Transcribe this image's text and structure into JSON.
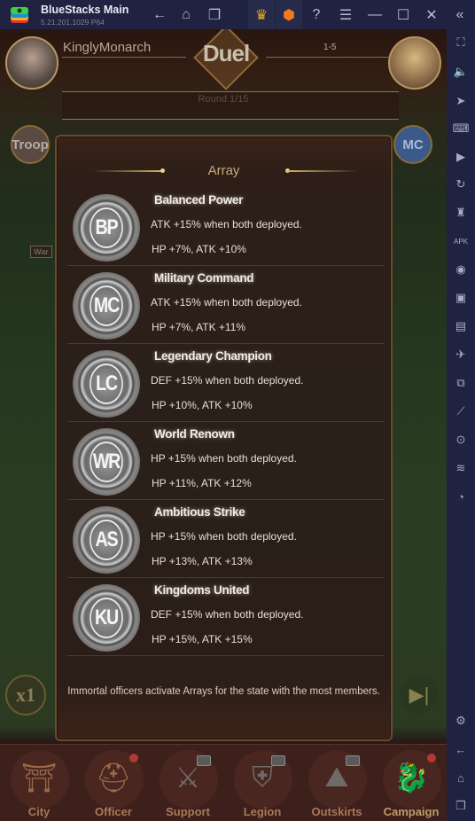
{
  "window": {
    "app_title": "BlueStacks Main",
    "version": "5.21.201.1029  P64",
    "toolbar": [
      {
        "name": "back-icon",
        "glyph": "←"
      },
      {
        "name": "home-icon",
        "glyph": "⌂"
      },
      {
        "name": "multi-instance-icon",
        "glyph": "❐"
      },
      {
        "name": "crown-icon",
        "glyph": "♛"
      },
      {
        "name": "hex-badge-icon",
        "glyph": "⬢"
      },
      {
        "name": "help-icon",
        "glyph": "?"
      },
      {
        "name": "menu-icon",
        "glyph": "☰"
      },
      {
        "name": "minimize-icon",
        "glyph": "—"
      },
      {
        "name": "maximize-icon",
        "glyph": "☐"
      },
      {
        "name": "close-icon",
        "glyph": "✕"
      },
      {
        "name": "collapse-sidebar-icon",
        "glyph": "«"
      }
    ]
  },
  "sidebar": {
    "items": [
      {
        "name": "fullscreen-icon",
        "glyph": "⛶"
      },
      {
        "name": "mute-icon",
        "glyph": "🔈"
      },
      {
        "name": "pointer-icon",
        "glyph": "➤"
      },
      {
        "name": "keyboard-icon",
        "glyph": "⌨"
      },
      {
        "name": "macro-play-icon",
        "glyph": "▶"
      },
      {
        "name": "rotate-sync-icon",
        "glyph": "↻"
      },
      {
        "name": "gamepad-controls-icon",
        "glyph": "♜"
      },
      {
        "name": "apk-install-icon",
        "glyph": "APK"
      },
      {
        "name": "screenshot-icon",
        "glyph": "◉"
      },
      {
        "name": "record-screen-icon",
        "glyph": "▣"
      },
      {
        "name": "media-folder-icon",
        "glyph": "▤"
      },
      {
        "name": "airplane-mode-icon",
        "glyph": "✈"
      },
      {
        "name": "multi-window-icon",
        "glyph": "⧉"
      },
      {
        "name": "shake-rotate-icon",
        "glyph": "⟋"
      },
      {
        "name": "location-icon",
        "glyph": "⊙"
      },
      {
        "name": "layers-icon",
        "glyph": "≋"
      },
      {
        "name": "performance-gauge-icon",
        "glyph": "◔"
      }
    ],
    "bottom": [
      {
        "name": "settings-icon",
        "glyph": "⚙"
      },
      {
        "name": "back-nav-icon",
        "glyph": "←"
      },
      {
        "name": "home-nav-icon",
        "glyph": "⌂"
      },
      {
        "name": "recent-apps-icon",
        "glyph": "❐"
      }
    ]
  },
  "game": {
    "player_name": "KinglyMonarch",
    "mode_title": "Duel",
    "stage": "1-5",
    "round": "Round 1/15",
    "left_badge": "Troop",
    "right_badge": "MC",
    "war_tag": "War",
    "speed": "x1",
    "skip_glyph": "▶|"
  },
  "array_modal": {
    "title": "Array",
    "rows": [
      {
        "abbr": "BP",
        "name": "Balanced Power",
        "desc": "ATK +15% when both deployed.",
        "stats": "HP +7%, ATK +10%"
      },
      {
        "abbr": "MC",
        "name": "Military Command",
        "desc": "ATK +15% when both deployed.",
        "stats": "HP +7%, ATK +11%"
      },
      {
        "abbr": "LC",
        "name": "Legendary Champion",
        "desc": "DEF +15% when both deployed.",
        "stats": "HP +10%, ATK +10%"
      },
      {
        "abbr": "WR",
        "name": "World Renown",
        "desc": "HP +15% when both deployed.",
        "stats": "HP +11%, ATK +12%"
      },
      {
        "abbr": "AS",
        "name": "Ambitious Strike",
        "desc": "HP +15% when both deployed.",
        "stats": "HP +13%, ATK +13%"
      },
      {
        "abbr": "KU",
        "name": "Kingdoms United",
        "desc": "DEF +15% when both deployed.",
        "stats": "HP +15%, ATK +15%"
      }
    ],
    "footnote": "Immortal officers activate Arrays for the state with the most members."
  },
  "bottom_nav": [
    {
      "label": "City",
      "glyph": "⛩",
      "locked": false,
      "alert": false
    },
    {
      "label": "Officer",
      "glyph": "⛑",
      "locked": false,
      "alert": true
    },
    {
      "label": "Support",
      "glyph": "⚔",
      "locked": true,
      "alert": false
    },
    {
      "label": "Legion",
      "glyph": "⛨",
      "locked": true,
      "alert": false
    },
    {
      "label": "Outskirts",
      "glyph": "⛰",
      "locked": true,
      "alert": false
    },
    {
      "label": "Campaign",
      "glyph": "🐉",
      "locked": false,
      "alert": true
    }
  ]
}
